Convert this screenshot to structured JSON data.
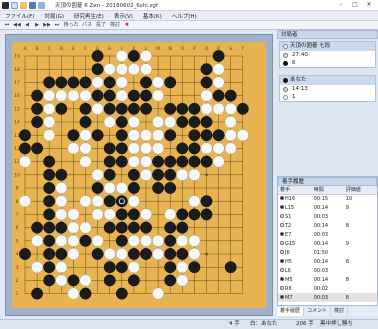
{
  "window": {
    "title": "天頂の囲碁 6 Zen - 20180602_6shi.sgf"
  },
  "menu": [
    "ファイル(F)",
    "対局(G)",
    "研究再生(E)",
    "表示(V)",
    "基本(K)",
    "ヘルプ(H)"
  ],
  "toolbar": {
    "takeback_label": "待った",
    "resign_label": "投了",
    "pass_label": "パス",
    "analyze_label": "検討"
  },
  "board": {
    "size": 19,
    "columns": [
      "A",
      "B",
      "C",
      "D",
      "E",
      "F",
      "G",
      "H",
      "J",
      "K",
      "L",
      "M",
      "N",
      "O",
      "P",
      "Q",
      "R",
      "S",
      "T"
    ],
    "rows_top_to_bottom": [
      "19",
      "18",
      "17",
      "16",
      "15",
      "14",
      "13",
      "12",
      "11",
      "10",
      "9",
      "8",
      "7",
      "6",
      "5",
      "4",
      "3",
      "2",
      "1"
    ],
    "colors": {
      "wood": "#e8b451",
      "line": "#6a4a16",
      "black": "#1b1b1b",
      "white": "#f7f7f7"
    },
    "stones": [
      "......b.wbw.....b..",
      "......bwwww....bw..",
      "..bbbbwbw.bwb..bw..",
      ".bwwwwbbwbbw...wbb.",
      ".bwb.bwbbbb.bbbwwwb",
      ".bw..b.wbw.wwbbb.w.",
      "b.w.bwb.bwwwb.bbbww",
      "bb..ww.bbwww.bbwww.",
      "w.b..w.bbwwbbbbbw..",
      "..bb..wb.bwbbww....",
      "..bw..bwwb.bb......",
      "w.bw.wwbbw....wb...",
      "..bww.wwbbw.wbbb...",
      ".bbbww.bbbb.bb.....",
      ".wbwwbw.bwwwbww....",
      "b.bbw.bwwbbwbbw....",
      ".wbw...bbw..bwb..b.",
      "..bwbw.b.b..bw.....",
      ".b..wb..b..w......."
    ],
    "last_move": "J8"
  },
  "game_info": {
    "header": "対局者",
    "player_top": {
      "name": "天頂の囲碁 七段",
      "time": "27:40",
      "captures": "6"
    },
    "player_bottom": {
      "name": "あなた",
      "time": "14:13",
      "captures": "1"
    }
  },
  "move_history": {
    "header": "着手履歴",
    "columns": [
      "着手",
      "時間",
      "評価値"
    ],
    "rows": [
      {
        "color": "black",
        "move": "H16",
        "time": "00:15",
        "eval": "10"
      },
      {
        "color": "black",
        "move": "L15",
        "time": "00:14",
        "eval": "9"
      },
      {
        "color": "white",
        "move": "S1",
        "time": "00:03",
        "eval": ""
      },
      {
        "color": "white",
        "move": "T2",
        "time": "00:14",
        "eval": "8"
      },
      {
        "color": "black",
        "move": "E7",
        "time": "00:03",
        "eval": ""
      },
      {
        "color": "white",
        "move": "G15",
        "time": "00:14",
        "eval": "9"
      },
      {
        "color": "white",
        "move": "J6",
        "time": "01:50",
        "eval": ""
      },
      {
        "color": "black",
        "move": "H5",
        "time": "00:14",
        "eval": "8"
      },
      {
        "color": "white",
        "move": "L6",
        "time": "00:03",
        "eval": ""
      },
      {
        "color": "black",
        "move": "M5",
        "time": "00:14",
        "eval": "8"
      },
      {
        "color": "white",
        "move": "R6",
        "time": "00:02",
        "eval": ""
      },
      {
        "color": "black",
        "move": "M7",
        "time": "00:03",
        "eval": "8"
      }
    ]
  },
  "tabs": [
    "着手履歴",
    "コメント",
    "検討"
  ],
  "status": {
    "move_number": "4 手",
    "turn": "白：あなた",
    "zoom": "206 手",
    "result_label": "黒中押し勝ち"
  }
}
